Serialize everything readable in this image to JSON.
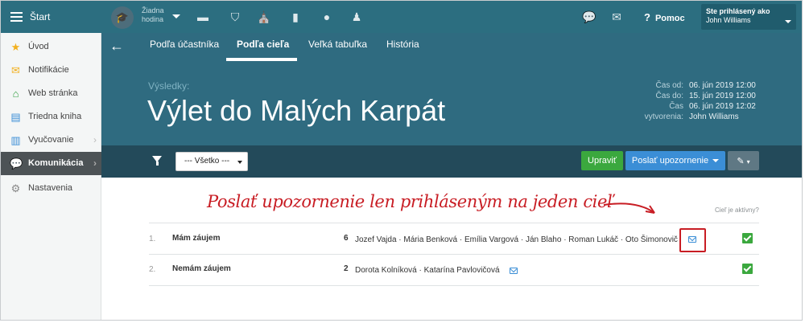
{
  "sidebar": {
    "title": "Štart",
    "items": [
      {
        "label": "Úvod",
        "icon": "star-icon",
        "color": "#f2b01e"
      },
      {
        "label": "Notifikácie",
        "icon": "envelope-icon",
        "color": "#f2b01e"
      },
      {
        "label": "Web stránka",
        "icon": "home-icon",
        "color": "#2e9e3e"
      },
      {
        "label": "Triedna kniha",
        "icon": "book-icon",
        "color": "#3b8ed6"
      },
      {
        "label": "Vyučovanie",
        "icon": "books-icon",
        "color": "#3b8ed6"
      },
      {
        "label": "Komunikácia",
        "icon": "chat-icon",
        "active": true
      },
      {
        "label": "Nastavenia",
        "icon": "gear-icon",
        "color": "#888888"
      }
    ]
  },
  "topbar": {
    "lesson_line1": "Žiadna",
    "lesson_line2": "hodina",
    "help_label": "Pomoc",
    "user_label": "Ste prihlásený ako",
    "user_name": "John Williams",
    "icons": [
      "graduation-cap-icon",
      "id-card-icon",
      "shield-icon",
      "institution-icon",
      "bar-chart-icon",
      "bell-icon",
      "walking-icon",
      "chat-icon",
      "envelope-icon"
    ]
  },
  "tabs": [
    {
      "label": "Podľa účastníka"
    },
    {
      "label": "Podľa cieľa",
      "active": true
    },
    {
      "label": "Veľká tabuľka"
    },
    {
      "label": "História"
    }
  ],
  "header": {
    "results_label": "Výsledky:",
    "title": "Výlet do Malých Karpát",
    "meta": [
      {
        "label": "Čas od:",
        "value": "06. jún 2019 12:00"
      },
      {
        "label": "Čas do:",
        "value": "15. jún 2019 12:00"
      },
      {
        "label": "Čas",
        "value": "06. jún 2019 12:02"
      },
      {
        "label": "vytvorenia:",
        "value": "John Williams"
      }
    ]
  },
  "toolbar": {
    "filter_value": "--- Všetko ---",
    "edit_label": "Upraviť",
    "notify_label": "Poslať upozornenie"
  },
  "content": {
    "annotation": "Poslať upozornenie len prihláseným na jeden cieľ",
    "active_header": "Cieľ je aktívny?",
    "rows": [
      {
        "num": "1.",
        "title": "Mám záujem",
        "count": "6",
        "names": "Jozef Vajda · Mária Benková · Emília Vargová · Ján Blaho · Roman Lukáč · Oto Šimonovič"
      },
      {
        "num": "2.",
        "title": "Nemám záujem",
        "count": "2",
        "names": "Dorota Kolníková · Katarína Pavlovičová"
      }
    ]
  },
  "colors": {
    "accent": "#2c6e80",
    "edit_button": "#3ba83e",
    "notify_button": "#3b8ed6",
    "highlight": "#c81d24"
  }
}
